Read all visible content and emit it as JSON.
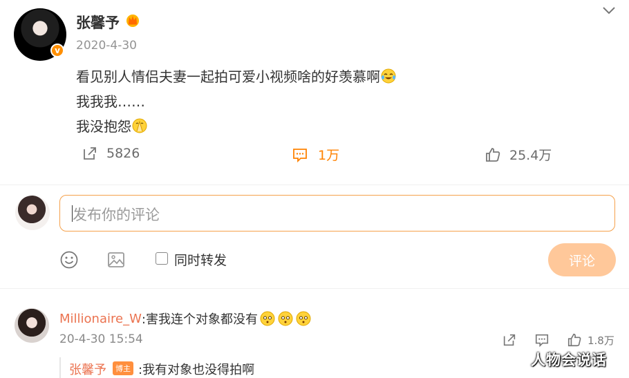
{
  "post": {
    "username": "张馨予",
    "date": "2020-4-30",
    "lines": [
      "看见别人情侣夫妻一起拍可爱小视频啥的好羡慕啊",
      "我我我……",
      "我没抱怨"
    ],
    "actions": {
      "repost": "5826",
      "comment": "1万",
      "like": "25.4万"
    }
  },
  "composer": {
    "placeholder": "发布你的评论",
    "also_repost_label": "同时转发",
    "submit_label": "评论"
  },
  "comment": {
    "user": "Millionaire_W",
    "text": ":害我连个对象都没有",
    "time": "20-4-30 15:54",
    "like_count": "1.8万",
    "reply": {
      "user": "张馨予",
      "badge": "博主",
      "text": ":我有对象也没得拍啊"
    }
  },
  "watermark": "人物会说话",
  "colors": {
    "accent": "#ff8200",
    "link": "#eb7350",
    "submit_bg": "#ffc89a"
  }
}
